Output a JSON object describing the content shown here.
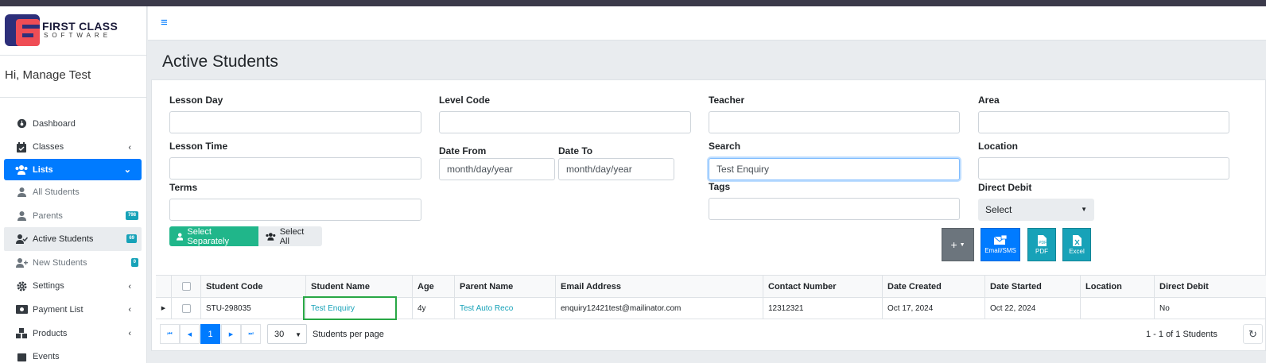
{
  "brand": {
    "line1": "FIRST CLASS",
    "line2": "SOFTWARE"
  },
  "user": {
    "greeting": "Hi, Manage Test"
  },
  "nav": {
    "dashboard": "Dashboard",
    "classes": "Classes",
    "lists": "Lists",
    "all_students": "All Students",
    "parents": "Parents",
    "parents_badge": "798",
    "active_students": "Active Students",
    "active_badge": "69",
    "new_students": "New Students",
    "new_badge": "0",
    "settings": "Settings",
    "payment_list": "Payment List",
    "products": "Products",
    "events": "Events"
  },
  "page": {
    "title": "Active Students"
  },
  "filters": {
    "lesson_day": {
      "label": "Lesson Day",
      "value": ""
    },
    "level_code": {
      "label": "Level Code",
      "value": ""
    },
    "teacher": {
      "label": "Teacher",
      "value": ""
    },
    "area": {
      "label": "Area",
      "value": ""
    },
    "lesson_time": {
      "label": "Lesson Time",
      "value": ""
    },
    "date_from": {
      "label": "Date From",
      "placeholder": "month/day/year"
    },
    "date_to": {
      "label": "Date To",
      "placeholder": "month/day/year"
    },
    "search": {
      "label": "Search",
      "value": "Test Enquiry"
    },
    "location": {
      "label": "Location",
      "value": ""
    },
    "terms": {
      "label": "Terms",
      "value": ""
    },
    "tags": {
      "label": "Tags",
      "value": ""
    },
    "direct_debit": {
      "label": "Direct Debit",
      "selected": "Select"
    }
  },
  "toggles": {
    "select_separately": "Select Separately",
    "select_all": "Select All"
  },
  "actions": {
    "email_sms": "Email/SMS",
    "pdf": "PDF",
    "excel": "Excel"
  },
  "table": {
    "headers": [
      "Student Code",
      "Student Name",
      "Age",
      "Parent Name",
      "Email Address",
      "Contact Number",
      "Date Created",
      "Date Started",
      "Location",
      "Direct Debit"
    ],
    "rows": [
      {
        "student_code": "STU-298035",
        "student_name": "Test Enquiry",
        "age": "4y",
        "parent_name": "Test Auto Reco",
        "email": "enquiry12421test@mailinator.com",
        "contact": "12312321",
        "date_created": "Oct 17, 2024",
        "date_started": "Oct 22, 2024",
        "location": "",
        "direct_debit": "No"
      }
    ]
  },
  "pager": {
    "current_page": "1",
    "page_size": "30",
    "per_page_label": "Students per page",
    "summary": "1 - 1 of 1 Students"
  },
  "colors": {
    "primary": "#007bff",
    "info": "#17a2b8",
    "success": "#20b68a",
    "highlight": "#28a745"
  }
}
